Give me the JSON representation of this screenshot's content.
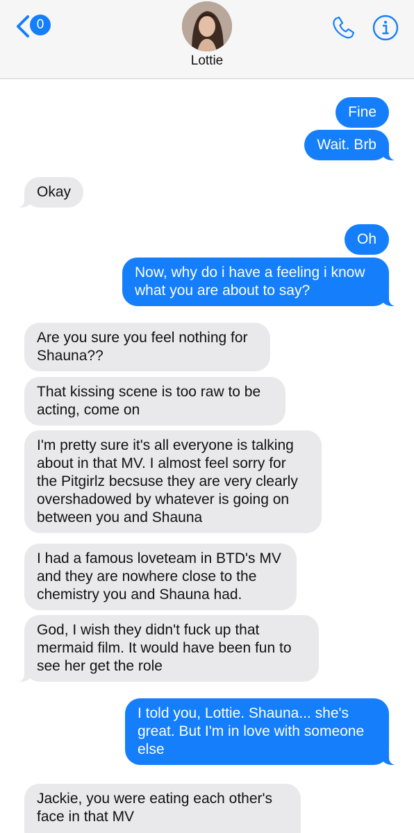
{
  "header": {
    "back_badge": "0",
    "contact_name": "Lottie"
  },
  "messages": [
    {
      "from": "me",
      "text": "Fine"
    },
    {
      "from": "me",
      "text": "Wait. Brb"
    },
    {
      "from": "them",
      "text": "Okay"
    },
    {
      "from": "me",
      "text": "Oh"
    },
    {
      "from": "me",
      "text": "Now, why do i have a feeling i know what you are about to say?"
    },
    {
      "from": "them",
      "text": "Are you sure you feel nothing for Shauna??"
    },
    {
      "from": "them",
      "text": "That kissing scene is too raw to be acting, come on"
    },
    {
      "from": "them",
      "text": "I'm pretty sure it's all everyone is talking about in that MV. I almost feel sorry for the Pitgirlz becsuse they are very clearly overshadowed by whatever is going on between you and Shauna"
    },
    {
      "from": "them",
      "text": "I had a famous loveteam in BTD's MV and they are nowhere close to the chemistry you and Shauna had."
    },
    {
      "from": "them",
      "text": "God, I wish they didn't fuck up that mermaid film. It would have been fun to see her get the role"
    },
    {
      "from": "me",
      "text": "I told you, Lottie. Shauna... she's great. But I'm in love with someone else"
    },
    {
      "from": "them",
      "text": "Jackie, you were eating each other's face in that MV"
    }
  ],
  "colors": {
    "accent": "#147efb",
    "incoming_bubble": "#e9e9eb",
    "header_bg": "#f6f6f7"
  },
  "icons": {
    "back": "chevron-left-icon",
    "call": "phone-icon",
    "info": "info-icon"
  }
}
